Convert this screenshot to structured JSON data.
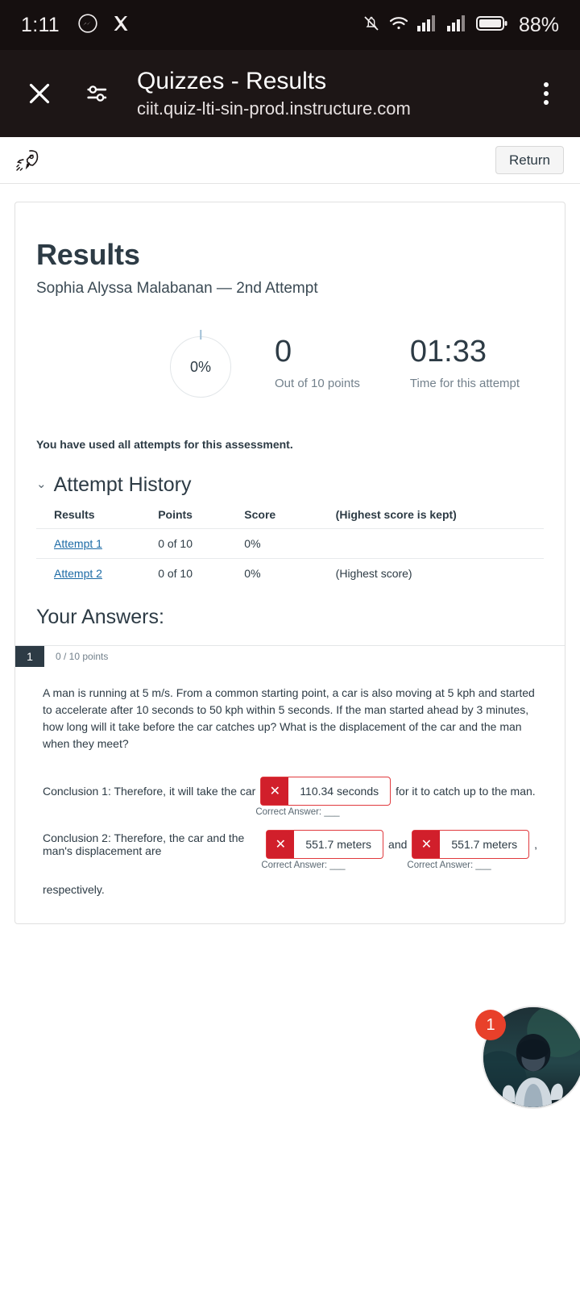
{
  "status_bar": {
    "time": "1:11",
    "battery_percent": "88%",
    "icons": [
      "messenger-icon",
      "x-twitter-icon",
      "notifications-off-icon",
      "wifi-icon",
      "signal-1-icon",
      "signal-2-icon",
      "battery-icon"
    ]
  },
  "app_bar": {
    "title": "Quizzes - Results",
    "url": "ciit.quiz-lti-sin-prod.instructure.com",
    "close_label": "✕",
    "icons": [
      "close-icon",
      "tune-icon",
      "overflow-menu-icon"
    ]
  },
  "toolbar": {
    "rocket_icon": "rocket-icon",
    "return_label": "Return"
  },
  "results": {
    "title": "Results",
    "subtitle": "Sophia Alyssa Malabanan — 2nd Attempt",
    "percent": "0%",
    "points_value": "0",
    "points_caption": "Out of 10 points",
    "time_value": "01:33",
    "time_caption": "Time for this attempt",
    "notice": "You have used all attempts for this assessment."
  },
  "attempt_history": {
    "heading": "Attempt History",
    "chevron": "⌄",
    "columns": [
      "Results",
      "Points",
      "Score",
      "(Highest score is kept)"
    ],
    "rows": [
      {
        "result": "Attempt 1",
        "points": "0 of 10",
        "score": "0%",
        "note": ""
      },
      {
        "result": "Attempt 2",
        "points": "0 of 10",
        "score": "0%",
        "note": "(Highest score)"
      }
    ]
  },
  "your_answers": {
    "heading": "Your Answers:",
    "question": {
      "number": "1",
      "points": "0 / 10 points",
      "text": "A man is running at 5 m/s. From a common starting point, a car is also moving at 5 kph and started to accelerate after 10 seconds to 50 kph within 5 seconds. If the man started ahead by 3 minutes, how long will it take before the car catches up? What is the displacement of the car and the man when they meet?",
      "conclusion1": {
        "prefix": "Conclusion 1: Therefore, it will take the car",
        "answer": "110.34 seconds",
        "suffix": "for it to catch up to the man.",
        "correct_label": "Correct Answer:",
        "correct_value": "___",
        "mark": "✕"
      },
      "conclusion2": {
        "prefix": "Conclusion 2: Therefore, the car and the man's displacement are",
        "answer1": "551.7 meters",
        "joiner": "and",
        "answer2": "551.7 meters",
        "tail": ",",
        "correct_label1": "Correct Answer:",
        "correct_value1": "___",
        "correct_label2": "Correct Answer:",
        "correct_value2": "___",
        "mark": "✕",
        "closing": "respectively."
      }
    }
  },
  "floating_bubble": {
    "badge_count": "1",
    "name": "video-call-bubble"
  },
  "colors": {
    "canvas_dark": "#2d3b45",
    "error_red": "#d11f2b",
    "link_blue": "#1b6aa5",
    "badge_red": "#e8402a"
  }
}
